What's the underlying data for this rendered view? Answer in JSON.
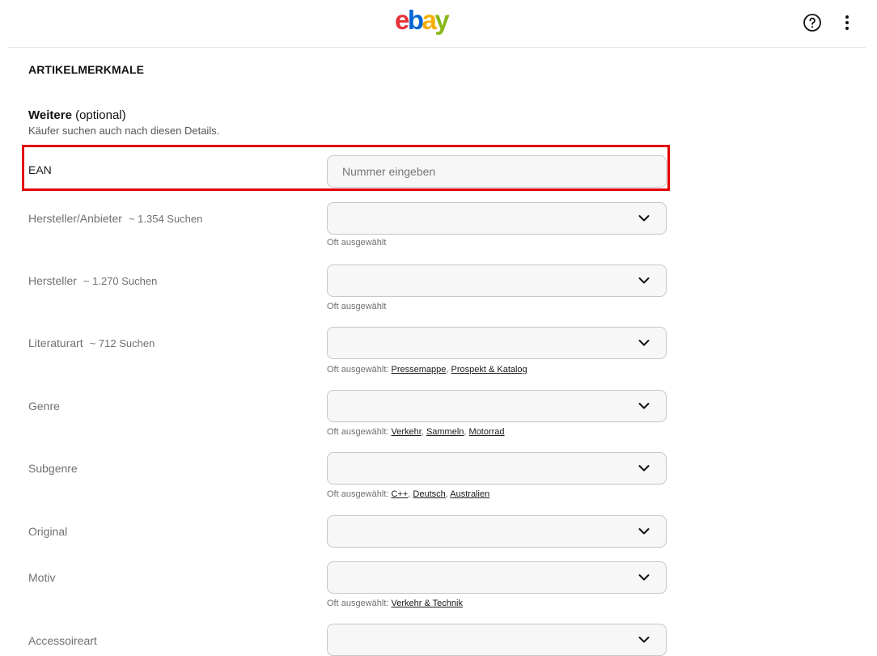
{
  "header": {
    "logo": [
      "e",
      "b",
      "a",
      "y"
    ],
    "help_icon": "help-circle-icon",
    "more_icon": "more-vertical-icon"
  },
  "colors": {
    "highlight_border": "#e10000",
    "logo_e": "#e53238",
    "logo_b": "#0064d2",
    "logo_a": "#f5af02",
    "logo_y": "#86b817"
  },
  "section": {
    "title": "ARTIKELMERKMALE",
    "group_title_bold": "Weitere",
    "group_title_rest": " (optional)",
    "group_subtitle": "Käufer suchen auch nach diesen Details."
  },
  "ean": {
    "label": "EAN",
    "placeholder": "Nummer eingeben",
    "value": ""
  },
  "hint_prefix": "Oft ausgewählt",
  "rows": {
    "hersteller_anbieter": {
      "label": "Hersteller/Anbieter",
      "count": "~ 1.354 Suchen",
      "hint": "Oft ausgewählt"
    },
    "hersteller": {
      "label": "Hersteller",
      "count": "~ 1.270 Suchen",
      "hint": "Oft ausgewählt"
    },
    "literaturart": {
      "label": "Literaturart",
      "count": "~ 712 Suchen",
      "hint_prefix": "Oft ausgewählt: ",
      "options": [
        "Pressemappe",
        "Prospekt & Katalog"
      ]
    },
    "genre": {
      "label": "Genre",
      "hint_prefix": "Oft ausgewählt: ",
      "options": [
        "Verkehr",
        "Sammeln",
        "Motorrad"
      ]
    },
    "subgenre": {
      "label": "Subgenre",
      "hint_prefix": "Oft ausgewählt: ",
      "options": [
        "C++",
        "Deutsch",
        "Australien"
      ]
    },
    "original": {
      "label": "Original"
    },
    "motiv": {
      "label": "Motiv",
      "hint_prefix": "Oft ausgewählt: ",
      "options": [
        "Verkehr & Technik"
      ]
    },
    "accessoireart": {
      "label": "Accessoireart"
    }
  }
}
